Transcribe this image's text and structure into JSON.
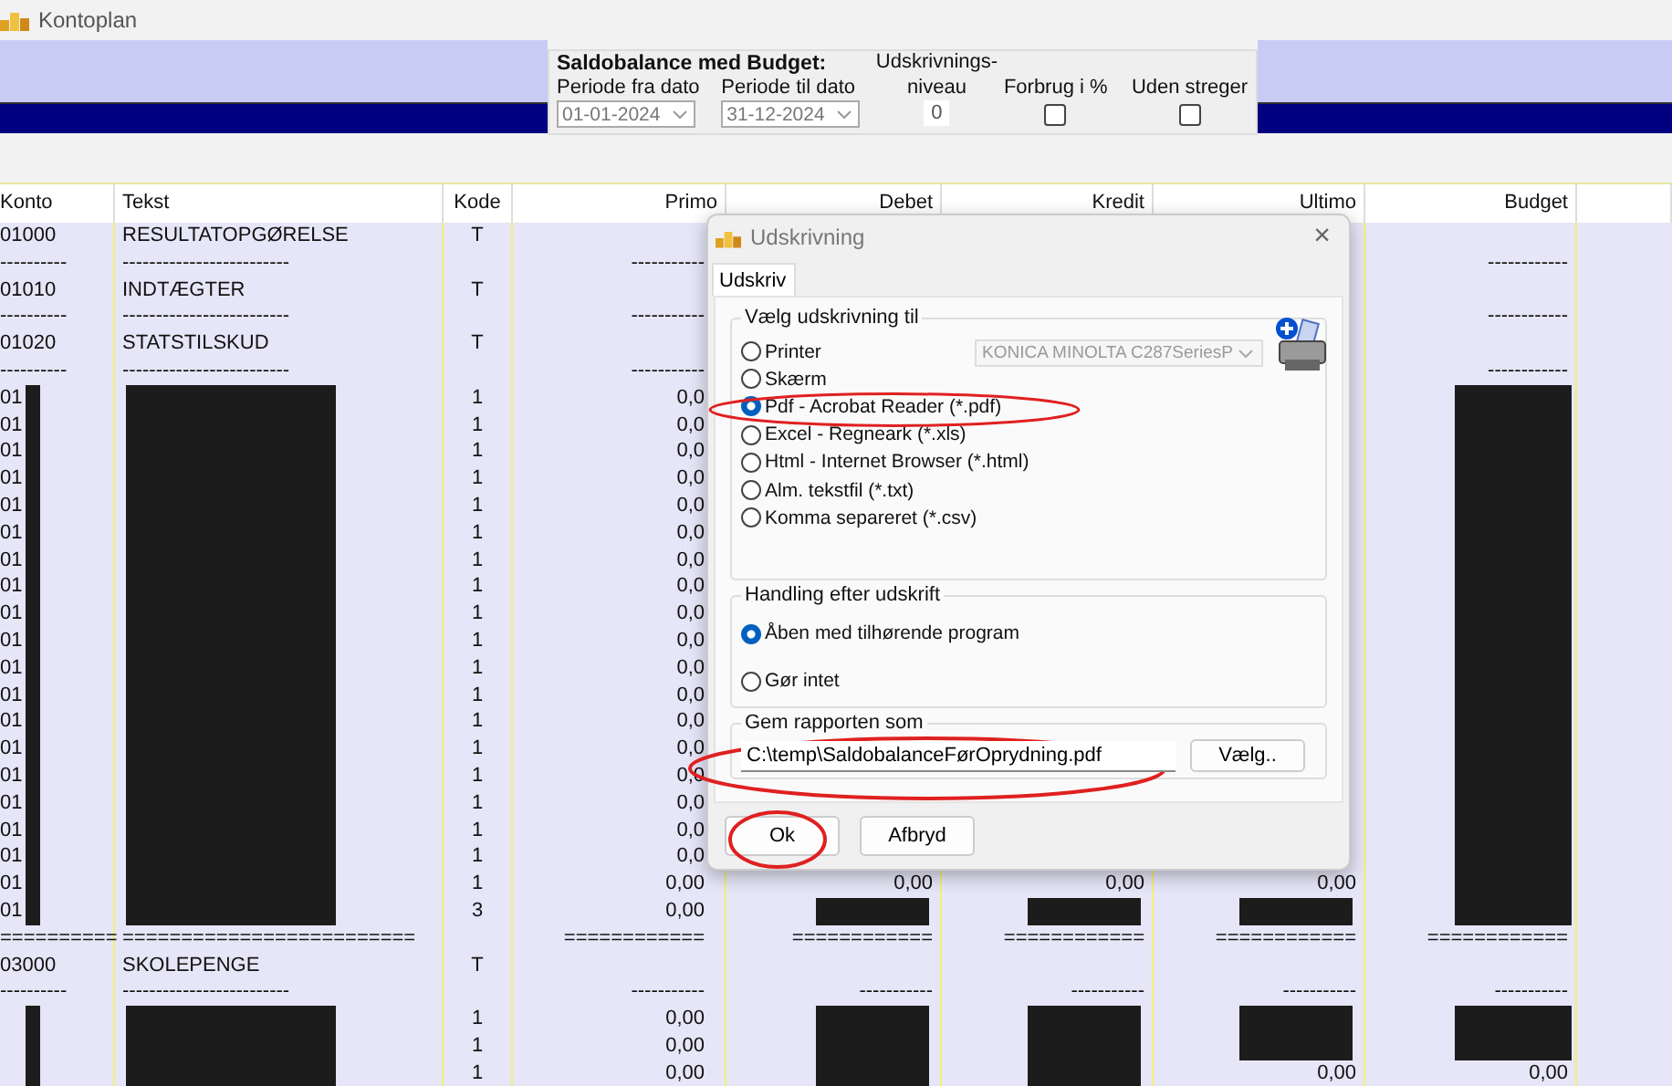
{
  "window": {
    "title": "Kontoplan"
  },
  "report_panel": {
    "title": "Saldobalance med Budget:",
    "fields": [
      {
        "kind": "combo",
        "label": "Periode fra dato",
        "value": "01-01-2024"
      },
      {
        "kind": "combo",
        "label": "Periode til dato",
        "value": "31-12-2024"
      },
      {
        "kind": "number",
        "label": "Udskrivnings-",
        "label_2": "niveau",
        "value": "0"
      },
      {
        "kind": "checkbox",
        "label": "Forbrug i %",
        "checked": false
      },
      {
        "kind": "checkbox",
        "label": "Uden streger",
        "checked": false
      }
    ]
  },
  "table": {
    "columns": [
      "Konto",
      "Tekst",
      "Kode",
      "Primo",
      "Debet",
      "Kredit",
      "Ultimo",
      "Budget"
    ],
    "rows": [
      {
        "kind": "plain",
        "cells": [
          "01000",
          "RESULTATOPGØRELSE",
          "T",
          null,
          null,
          null,
          null,
          null
        ]
      },
      {
        "kind": "plain",
        "cells": [
          "----------",
          "-------------------------",
          null,
          "-----------",
          null,
          null,
          null,
          "------------"
        ]
      },
      {
        "kind": "plain",
        "cells": [
          "01010",
          "INDTÆGTER",
          "T",
          null,
          null,
          null,
          null,
          null
        ]
      },
      {
        "kind": "plain",
        "cells": [
          "----------",
          "-------------------------",
          null,
          "-----------",
          null,
          null,
          null,
          "------------"
        ]
      },
      {
        "kind": "plain",
        "cells": [
          "01020",
          "STATSTILSKUD",
          "T",
          null,
          null,
          null,
          null,
          null
        ]
      },
      {
        "kind": "plain",
        "cells": [
          "----------",
          "-------------------------",
          null,
          "-----------",
          null,
          null,
          null,
          "------------"
        ]
      },
      {
        "kind": "masked",
        "cells": [
          "01",
          null,
          "1",
          "0,0",
          null,
          null,
          null,
          null
        ]
      },
      {
        "kind": "masked",
        "cells": [
          "01",
          null,
          "1",
          "0,0",
          null,
          null,
          null,
          null
        ]
      },
      {
        "kind": "masked",
        "cells": [
          "01",
          null,
          "1",
          "0,0",
          null,
          null,
          null,
          null
        ]
      },
      {
        "kind": "masked",
        "cells": [
          "01",
          null,
          "1",
          "0,0",
          null,
          null,
          null,
          null
        ]
      },
      {
        "kind": "masked",
        "cells": [
          "01",
          null,
          "1",
          "0,0",
          null,
          null,
          null,
          null
        ]
      },
      {
        "kind": "masked",
        "cells": [
          "01",
          null,
          "1",
          "0,0",
          null,
          null,
          null,
          null
        ]
      },
      {
        "kind": "masked",
        "cells": [
          "01",
          null,
          "1",
          "0,0",
          null,
          null,
          null,
          null
        ]
      },
      {
        "kind": "masked",
        "cells": [
          "01",
          null,
          "1",
          "0,0",
          null,
          null,
          null,
          null
        ]
      },
      {
        "kind": "masked",
        "cells": [
          "01",
          null,
          "1",
          "0,0",
          null,
          null,
          null,
          null
        ]
      },
      {
        "kind": "masked",
        "cells": [
          "01",
          null,
          "1",
          "0,0",
          null,
          null,
          null,
          null
        ]
      },
      {
        "kind": "masked",
        "cells": [
          "01",
          null,
          "1",
          "0,0",
          null,
          null,
          null,
          null
        ]
      },
      {
        "kind": "masked",
        "cells": [
          "01",
          null,
          "1",
          "0,0",
          null,
          null,
          null,
          null
        ]
      },
      {
        "kind": "masked",
        "cells": [
          "01",
          null,
          "1",
          "0,0",
          null,
          null,
          null,
          null
        ]
      },
      {
        "kind": "masked",
        "cells": [
          "01",
          null,
          "1",
          "0,0",
          null,
          null,
          null,
          null
        ]
      },
      {
        "kind": "masked",
        "cells": [
          "01",
          null,
          "1",
          "0,0",
          null,
          null,
          null,
          null
        ]
      },
      {
        "kind": "masked",
        "cells": [
          "01",
          null,
          "1",
          "0,0",
          null,
          null,
          null,
          null
        ]
      },
      {
        "kind": "masked",
        "cells": [
          "01",
          null,
          "1",
          "0,0",
          null,
          null,
          null,
          null
        ]
      },
      {
        "kind": "masked",
        "cells": [
          "01",
          null,
          "1",
          "0,0",
          null,
          null,
          null,
          null
        ]
      },
      {
        "kind": "masked",
        "cells": [
          "01",
          null,
          "1",
          "0,00",
          "0,00",
          "0,00",
          "0,00",
          null
        ]
      },
      {
        "kind": "masked_sum",
        "cells": [
          "01",
          null,
          "3",
          "0,00",
          null,
          null,
          null,
          null
        ]
      },
      {
        "kind": "plain",
        "cells": [
          "==========",
          "=========================",
          null,
          "============",
          "============",
          "============",
          "============",
          "============"
        ]
      },
      {
        "kind": "plain",
        "cells": [
          "03000",
          "SKOLEPENGE",
          "T",
          null,
          null,
          null,
          null,
          null
        ]
      },
      {
        "kind": "plain",
        "cells": [
          "----------",
          "-------------------------",
          null,
          "-----------",
          "-----------",
          "-----------",
          "-----------",
          "-----------"
        ]
      },
      {
        "kind": "masked_sum",
        "cells": [
          null,
          null,
          "1",
          "0,00",
          null,
          null,
          null,
          null
        ]
      },
      {
        "kind": "masked_sum",
        "cells": [
          null,
          null,
          "1",
          "0,00",
          null,
          null,
          null,
          null
        ]
      },
      {
        "kind": "masked_part",
        "cells": [
          null,
          null,
          "1",
          "0,00",
          null,
          null,
          "0,00",
          "0,00"
        ]
      }
    ]
  },
  "dialog": {
    "title": "Udskrivning",
    "close": "×",
    "tabs": [
      {
        "label": "Udskriv",
        "selected": true
      }
    ],
    "output_group": {
      "title": "Vælg udskrivning til",
      "printer": "KONICA MINOLTA C287SeriesP",
      "options": [
        {
          "label": "Printer",
          "selected": false
        },
        {
          "label": "Skærm",
          "selected": false
        },
        {
          "label": "Pdf - Acrobat Reader (*.pdf)",
          "selected": true
        },
        {
          "label": "Excel - Regneark (*.xls)",
          "selected": false
        },
        {
          "label": "Html - Internet Browser (*.html)",
          "selected": false
        },
        {
          "label": "Alm. tekstfil (*.txt)",
          "selected": false
        },
        {
          "label": "Komma separeret (*.csv)",
          "selected": false
        }
      ]
    },
    "action_group": {
      "title": "Handling efter udskrift",
      "options": [
        {
          "label": "Åben med tilhørende program",
          "selected": true
        },
        {
          "label": "Gør intet",
          "selected": false
        }
      ]
    },
    "save_group": {
      "title": "Gem rapporten som",
      "value": "C:\\temp\\SaldobalanceFørOprydning.pdf",
      "browse": "Vælg.."
    },
    "buttons": [
      "Ok",
      "Afbryd"
    ]
  }
}
